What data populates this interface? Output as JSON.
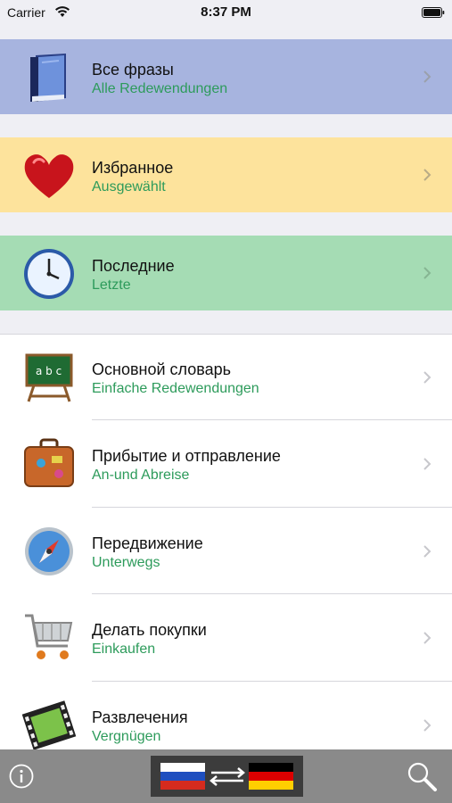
{
  "status_bar": {
    "carrier": "Carrier",
    "time": "8:37 PM"
  },
  "top_rows": [
    {
      "title": "Все фразы",
      "subtitle": "Alle Redewendungen",
      "bg": "#a7b4df",
      "icon": "book-icon"
    },
    {
      "title": "Избранное",
      "subtitle": "Ausgewählt",
      "bg": "#fde39c",
      "icon": "heart-icon"
    },
    {
      "title": "Последние",
      "subtitle": "Letzte",
      "bg": "#a5dcb4",
      "icon": "clock-icon"
    }
  ],
  "categories": [
    {
      "title": "Основной словарь",
      "subtitle": "Einfache Redewendungen",
      "icon": "chalkboard-icon"
    },
    {
      "title": "Прибытие и отправление",
      "subtitle": "An-und Abreise",
      "icon": "suitcase-icon"
    },
    {
      "title": "Передвижение",
      "subtitle": "Unterwegs",
      "icon": "compass-icon"
    },
    {
      "title": "Делать покупки",
      "subtitle": "Einkaufen",
      "icon": "shopping-cart-icon"
    },
    {
      "title": "Развлечения",
      "subtitle": "Vergnügen",
      "icon": "film-strip-icon"
    }
  ],
  "colors": {
    "subtitle": "#2d9b5b",
    "toolbar": "#8a8a8a",
    "background": "#efeff4"
  },
  "toolbar": {
    "info_icon": "info-icon",
    "flags_icon": "russian-german-flags-icon",
    "search_icon": "search-icon"
  }
}
